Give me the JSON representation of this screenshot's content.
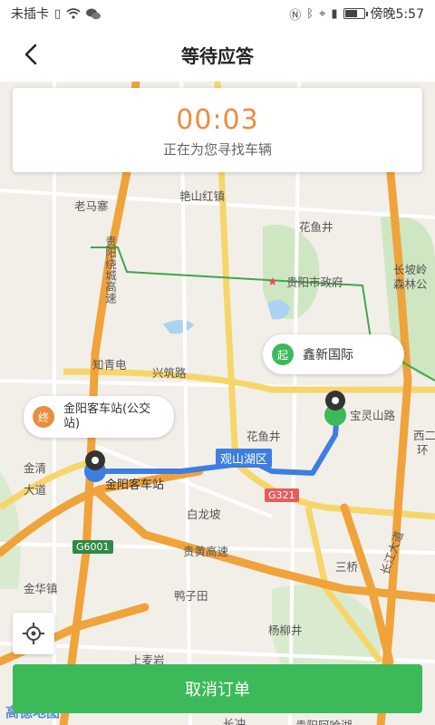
{
  "status_bar": {
    "carrier": "未插卡",
    "time": "傍晚5:57",
    "battery_level": 0.7,
    "icons": [
      "sim-icon",
      "wifi-icon",
      "wechat-icon",
      "nfc-icon",
      "bluetooth-icon",
      "location-icon",
      "vibrate-icon",
      "battery-icon"
    ]
  },
  "nav": {
    "title": "等待应答",
    "back_icon": "chevron-left-icon"
  },
  "status_card": {
    "timer": "00:03",
    "message": "正在为您寻找车辆"
  },
  "map": {
    "labels": {
      "laomazhai": "老马寨",
      "yanshanhong": "艳山红镇",
      "huayujing_top": "花鱼井",
      "guiyang_gov": "贵阳市政府",
      "changpoling": "长坡岭",
      "senlingong": "森林公",
      "zhiqingdian": "知青电",
      "xingzhulu": "兴筑路",
      "huayujing_mid": "花鱼井",
      "baolingshanlu": "宝灵山路",
      "xier": "西二",
      "huan": "环",
      "jinqing": "金清",
      "dadao": "大道",
      "bailongpo": "白龙坡",
      "guihuang": "贵黄高速",
      "sanqiao": "三桥",
      "jinhuazhen": "金华镇",
      "yazitian": "鸭子田",
      "yangliujing": "杨柳井",
      "changjiang_dadao": "长江大道",
      "shangmaiyan": "上麦岩",
      "changchong": "长冲",
      "guiyang_ahu": "贵阳阿哈湖",
      "guiyang_xian": "贵阳绕城高速",
      "jinyang_station": "金阳客车站",
      "guanshanhu": "观山湖区",
      "map_logo": "高德地图"
    },
    "shields": {
      "g321": "G321",
      "g6001": "G6001"
    },
    "start_pin": {
      "badge": "起",
      "label": "鑫新国际"
    },
    "end_pin": {
      "badge": "终",
      "label": "金阳客车站(公交站)"
    },
    "colors": {
      "route": "#3d7ee0",
      "start": "#3cba59",
      "end": "#e98e3c"
    }
  },
  "controls": {
    "locate_icon": "locate-crosshair-icon"
  },
  "footer": {
    "cancel_label": "取消订单"
  }
}
